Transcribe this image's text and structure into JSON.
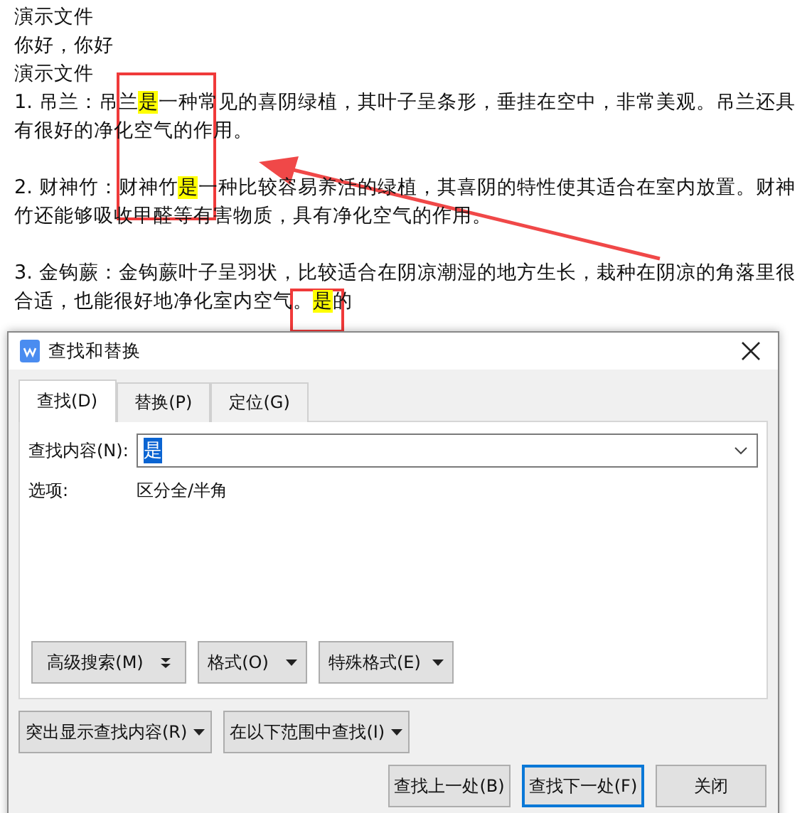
{
  "document": {
    "paragraphs": [
      {
        "spaced": false,
        "segments": [
          {
            "text": "演示文件",
            "highlight": false
          }
        ]
      },
      {
        "spaced": false,
        "segments": [
          {
            "text": "你好，你好",
            "highlight": false
          }
        ]
      },
      {
        "spaced": false,
        "segments": [
          {
            "text": "演示文件",
            "highlight": false
          }
        ]
      },
      {
        "spaced": false,
        "segments": [
          {
            "text": "1. 吊兰：吊兰",
            "highlight": false
          },
          {
            "text": "是",
            "highlight": true
          },
          {
            "text": "一种常见的喜阴绿植，其叶子呈条形，垂挂在空中，非常美观。吊兰还具有很好的净化空气的作用。",
            "highlight": false
          }
        ]
      },
      {
        "spaced": true,
        "segments": [
          {
            "text": "2. 财神竹：财神竹",
            "highlight": false
          },
          {
            "text": "是",
            "highlight": true
          },
          {
            "text": "一种比较容易养活的绿植，其喜阴的特性使其适合在室内放置。财神竹还能够吸收甲醛等有害物质，具有净化空气的作用。",
            "highlight": false
          }
        ]
      },
      {
        "spaced": true,
        "segments": [
          {
            "text": "3. 金钩蕨：金钩蕨叶子呈羽状，比较适合在阴凉潮湿的地方生长，栽种在阴凉的角落里很合适，也能很好地净化室内空气。",
            "highlight": false
          },
          {
            "text": "是",
            "highlight": true
          },
          {
            "text": "的",
            "highlight": false
          }
        ]
      }
    ]
  },
  "dialog": {
    "title": "查找和替换",
    "tabs": [
      {
        "label": "查找(D)",
        "selected": true
      },
      {
        "label": "替换(P)",
        "selected": false
      },
      {
        "label": "定位(G)",
        "selected": false
      }
    ],
    "find_label": "查找内容(N):",
    "find_value": "是",
    "options_label": "选项:",
    "options_value": "区分全/半角",
    "panel_buttons": [
      {
        "label": "高级搜索(M)",
        "kind": "expand"
      },
      {
        "label": "格式(O)",
        "kind": "menu"
      },
      {
        "label": "特殊格式(E)",
        "kind": "menu"
      }
    ],
    "menu_buttons": [
      {
        "label": "突出显示查找内容(R)",
        "kind": "menu"
      },
      {
        "label": "在以下范围中查找(I)",
        "kind": "menu"
      }
    ],
    "buttons": [
      {
        "label": "查找上一处(B)",
        "focused": false
      },
      {
        "label": "查找下一处(F)",
        "focused": true
      },
      {
        "label": "关闭",
        "focused": false
      }
    ]
  }
}
